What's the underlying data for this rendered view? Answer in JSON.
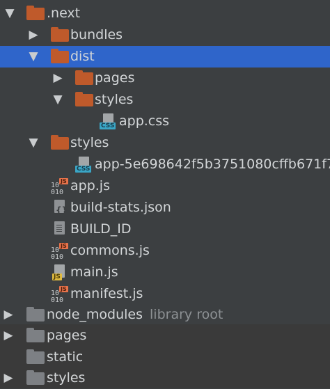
{
  "tree": {
    "next_label": ".next",
    "bundles_label": "bundles",
    "dist_label": "dist",
    "pages_label": "pages",
    "styles_label": "styles",
    "app_css_label": "app.css",
    "styles2_label": "styles",
    "app_hash_css_label": "app-5e698642f5b3751080cffb671f7",
    "app_js_label": "app.js",
    "build_stats_label": "build-stats.json",
    "build_id_label": "BUILD_ID",
    "commons_js_label": "commons.js",
    "main_js_label": "main.js",
    "manifest_js_label": "manifest.js",
    "node_modules_label": "node_modules",
    "node_modules_suffix": "library root",
    "root_pages_label": "pages",
    "static_label": "static",
    "root_styles_label": "styles"
  },
  "icons": {
    "expanded": "▼",
    "collapsed": "▶",
    "css_badge": "CSS",
    "js_badge": "JS",
    "binary_bits": "10\n010"
  },
  "colors": {
    "background": "#3c3f41",
    "selection": "#2f65ca",
    "folder_orange": "#bf5a2b",
    "folder_grey": "#7d8084",
    "css_badge": "#3aa6c6",
    "js_badge": "#e0ba3f"
  }
}
